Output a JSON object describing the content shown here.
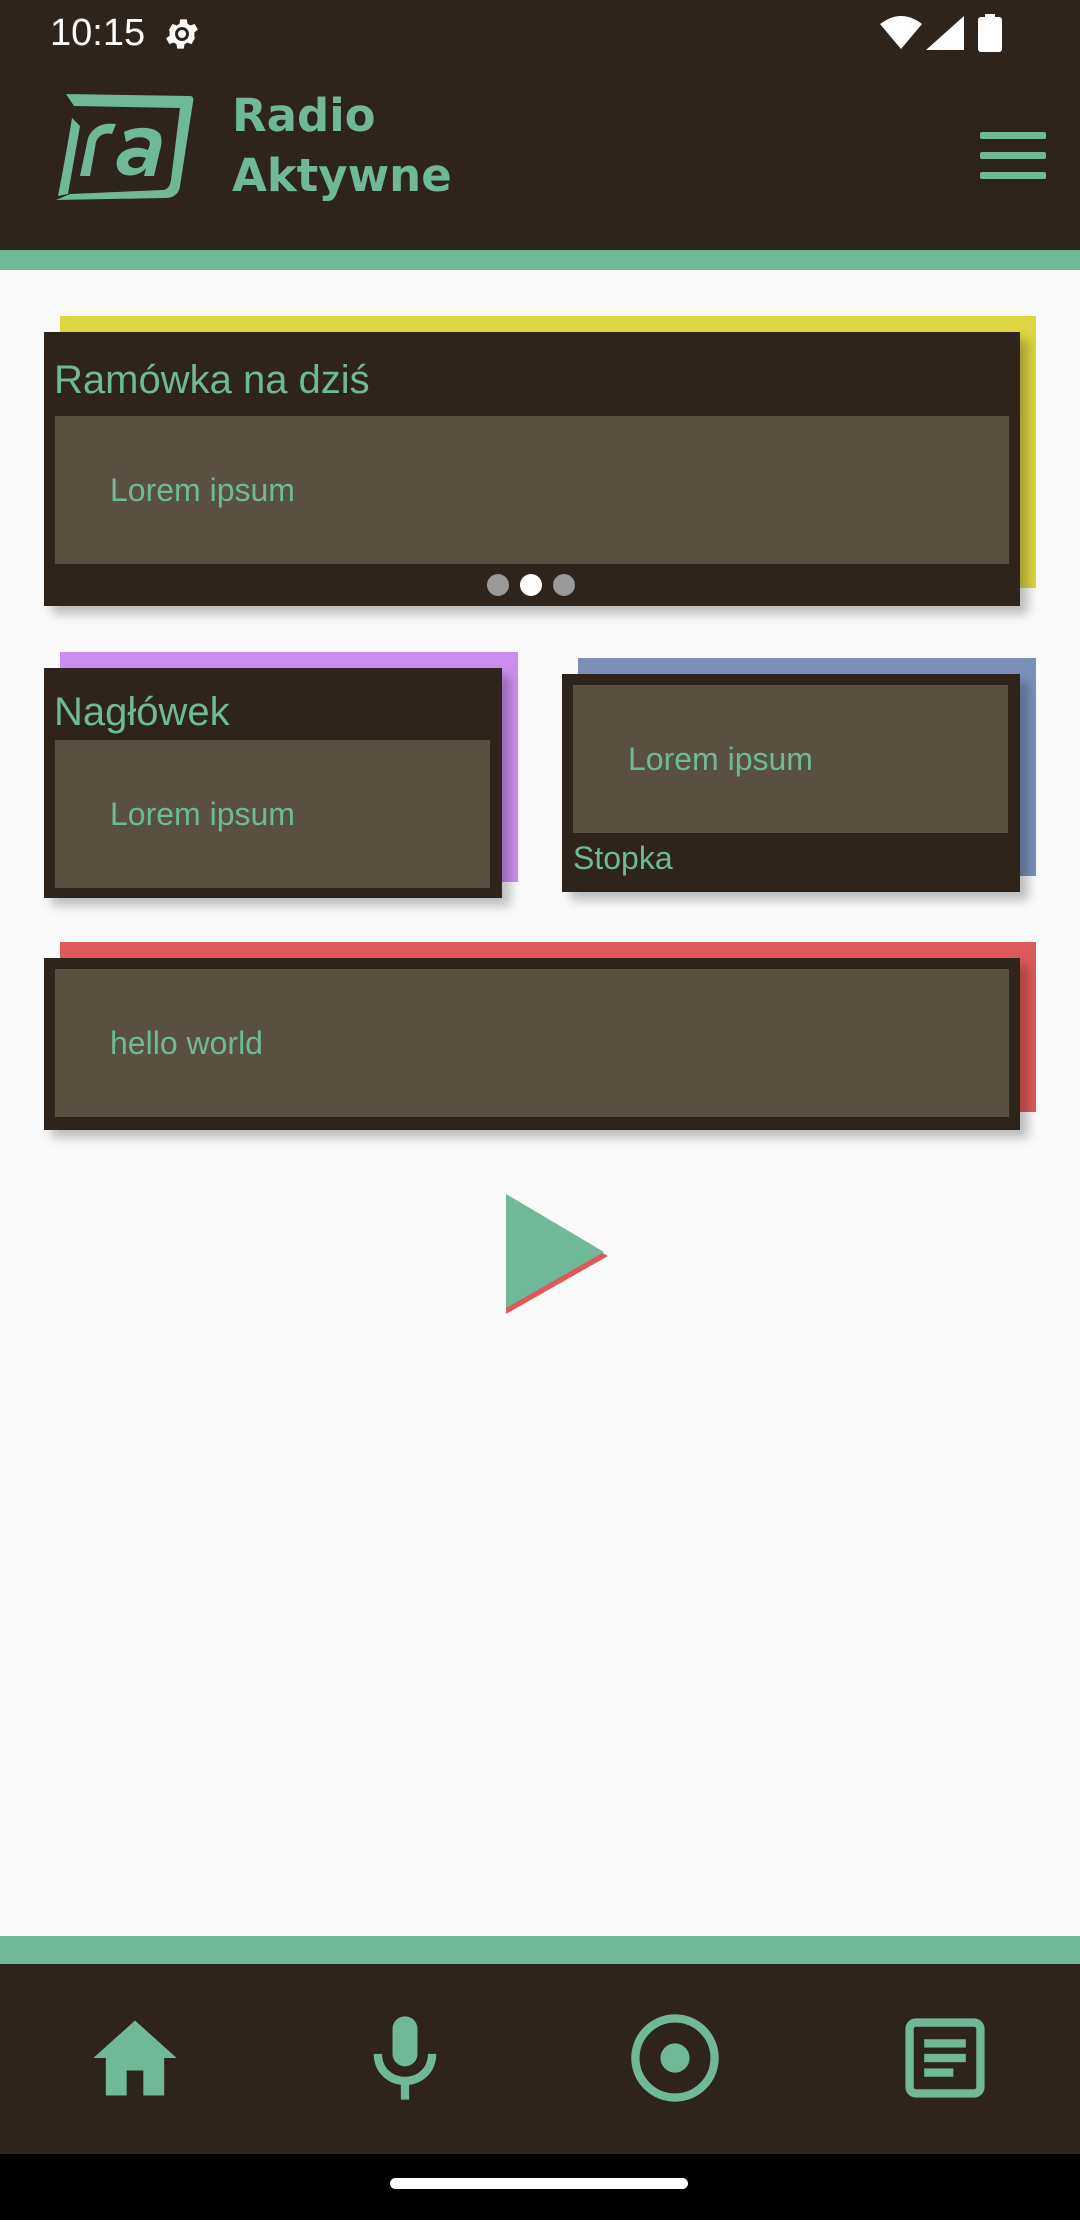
{
  "status_bar": {
    "time": "10:15",
    "icons": [
      "gear-icon",
      "wifi-icon",
      "signal-icon",
      "battery-icon"
    ]
  },
  "app_bar": {
    "brand_line1": "Radio",
    "brand_line2": "Aktywne",
    "logo_icon": "radio-aktywne-logo",
    "menu_icon": "menu-icon"
  },
  "cards": {
    "schedule": {
      "title": "Ramówka na dziś",
      "body": "Lorem ipsum",
      "accent_color": "#dcd640",
      "pager_dots": 3,
      "active_dot": 2
    },
    "header_card": {
      "title": "Nagłówek",
      "body": "Lorem ipsum",
      "accent_color": "#c98ff0"
    },
    "footer_card": {
      "body": "Lorem ipsum",
      "footer": "Stopka",
      "accent_color": "#7a90b8"
    },
    "hello_card": {
      "body": "hello world",
      "accent_color": "#dd5a5a"
    }
  },
  "player": {
    "play_icon": "play-icon"
  },
  "bottom_nav": {
    "items": [
      {
        "icon": "home-icon"
      },
      {
        "icon": "microphone-icon"
      },
      {
        "icon": "radio-disc-icon"
      },
      {
        "icon": "article-icon"
      }
    ]
  },
  "colors": {
    "primary": "#6fb898",
    "dark": "#2f241b",
    "inner": "#5a5041",
    "background": "#fafafa"
  }
}
